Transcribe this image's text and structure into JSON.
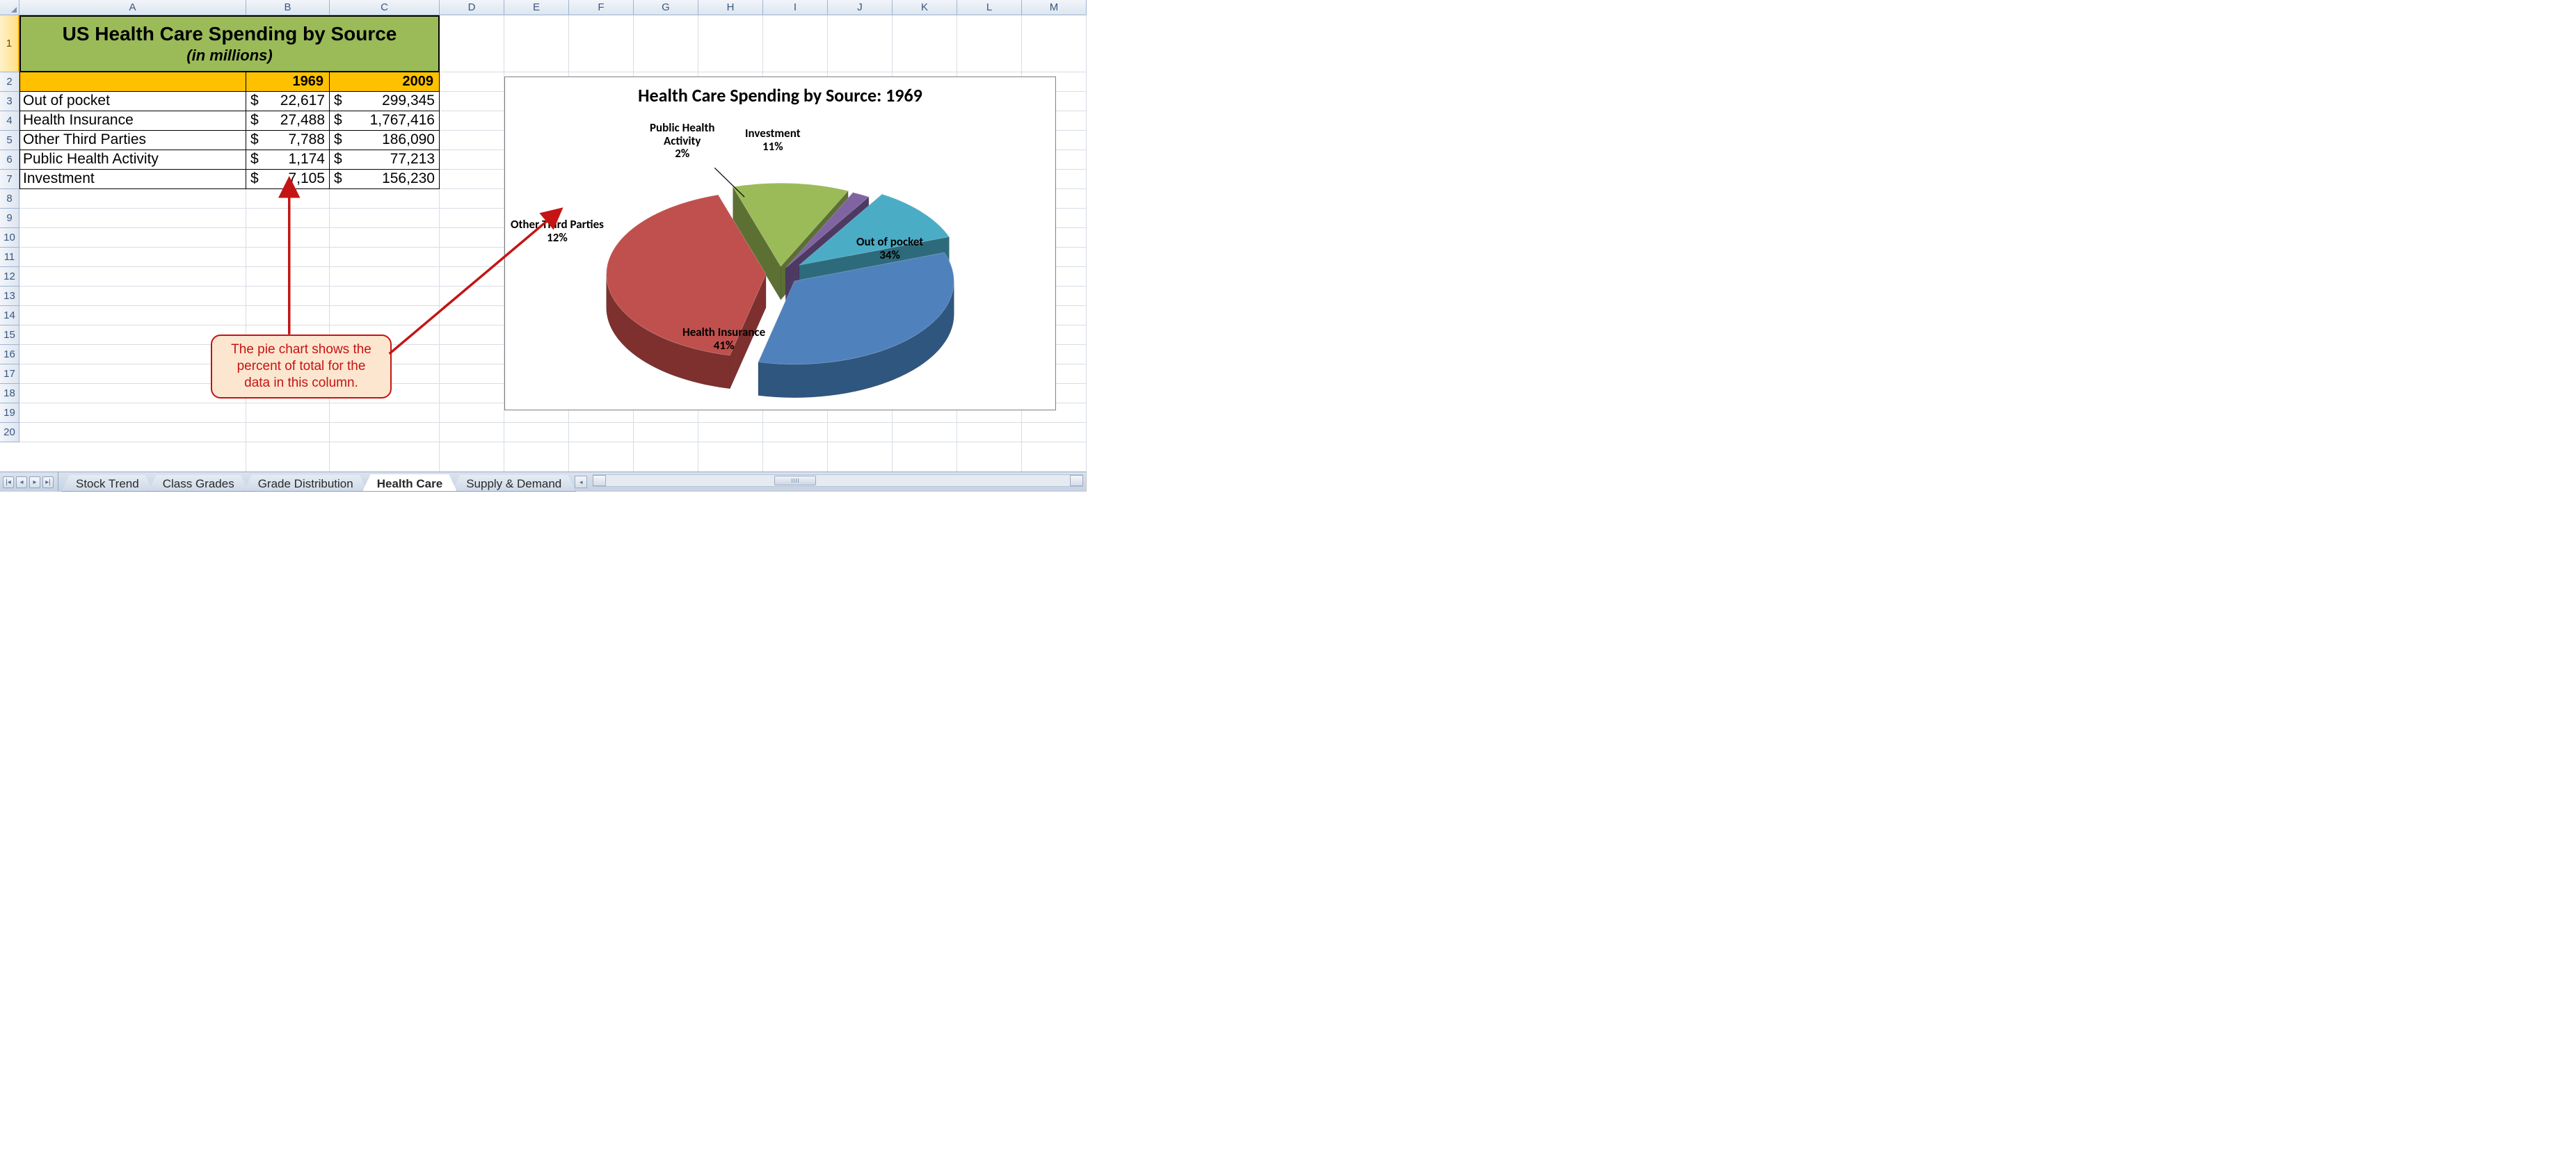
{
  "columns": [
    "A",
    "B",
    "C",
    "D",
    "E",
    "F",
    "G",
    "H",
    "I",
    "J",
    "K",
    "L",
    "M"
  ],
  "rows": {
    "count": 20,
    "heights": [
      82,
      28,
      28,
      28,
      28,
      28,
      28,
      28,
      28,
      28,
      28,
      28,
      28,
      28,
      28,
      28,
      28,
      28,
      28,
      28
    ]
  },
  "table": {
    "title": "US Health Care Spending by Source",
    "subtitle": "(in millions)",
    "year_b": "1969",
    "year_c": "2009",
    "currency": "$",
    "rows": [
      {
        "label": "Out of pocket",
        "b": "22,617",
        "c": "299,345"
      },
      {
        "label": "Health Insurance",
        "b": "27,488",
        "c": "1,767,416"
      },
      {
        "label": "Other Third Parties",
        "b": "7,788",
        "c": "186,090"
      },
      {
        "label": "Public Health Activity",
        "b": "1,174",
        "c": "77,213"
      },
      {
        "label": "Investment",
        "b": "7,105",
        "c": "156,230"
      }
    ]
  },
  "callout": "The pie chart shows the percent of total for the data in this column.",
  "chart_data": {
    "type": "pie",
    "title": "Health Care Spending by Source: 1969",
    "series": [
      {
        "name": "Out of pocket",
        "value": 22617,
        "percent": 34,
        "color_top": "#4f81bd",
        "color_side": "#2f567f"
      },
      {
        "name": "Health Insurance",
        "value": 27488,
        "percent": 41,
        "color_top": "#c0504d",
        "color_side": "#7e302e"
      },
      {
        "name": "Other Third Parties",
        "value": 7788,
        "percent": 12,
        "color_top": "#9bbb59",
        "color_side": "#5c7033"
      },
      {
        "name": "Public Health Activity",
        "value": 1174,
        "percent": 2,
        "color_top": "#8064a2",
        "color_side": "#4d3a63"
      },
      {
        "name": "Investment",
        "value": 7105,
        "percent": 11,
        "color_top": "#4bacc6",
        "color_side": "#2d6b7c"
      }
    ],
    "labels": {
      "out_name": "Out of pocket",
      "out_pct": "34%",
      "hi_name": "Health Insurance",
      "hi_pct": "41%",
      "otp_name": "Other Third Parties",
      "otp_pct": "12%",
      "pha_name1": "Public Health",
      "pha_name2": "Activity",
      "pha_pct": "2%",
      "inv_name": "Investment",
      "inv_pct": "11%"
    }
  },
  "tabs": {
    "items": [
      "Stock Trend",
      "Class Grades",
      "Grade Distribution",
      "Health Care",
      "Supply & Demand"
    ],
    "active": "Health Care"
  }
}
